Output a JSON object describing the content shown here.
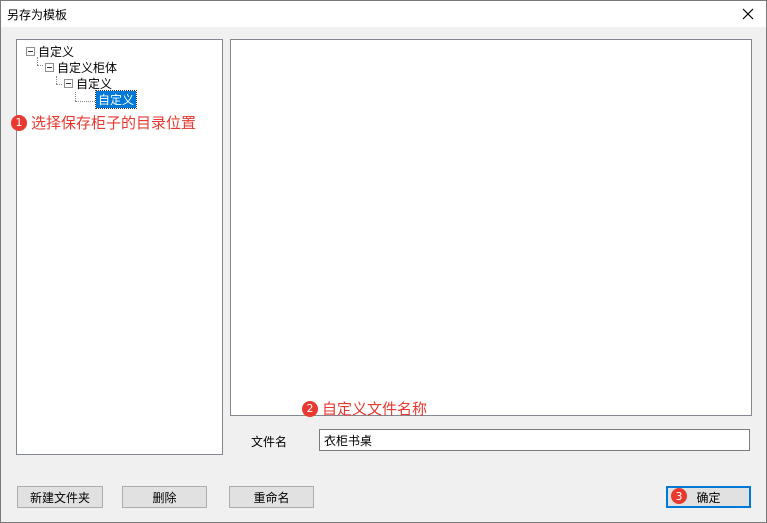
{
  "window": {
    "title": "另存为模板",
    "close_icon": "close-icon"
  },
  "tree": {
    "nodes": [
      {
        "label": "自定义",
        "expanded": true
      },
      {
        "label": "自定义柜体",
        "expanded": true
      },
      {
        "label": "自定义",
        "expanded": true
      },
      {
        "label": "自定义",
        "selected": true
      }
    ]
  },
  "annotations": {
    "step1": {
      "number": "1",
      "text": "选择保存柜子的目录位置"
    },
    "step2": {
      "number": "2",
      "text": "自定义文件名称"
    },
    "step3": {
      "number": "3"
    }
  },
  "form": {
    "filename_label": "文件名",
    "filename_value": "衣柜书桌"
  },
  "buttons": {
    "new_folder": "新建文件夹",
    "delete": "删除",
    "rename": "重命名",
    "ok": "确定"
  },
  "colors": {
    "annotation": "#e8382f",
    "selection": "#0078d7"
  }
}
